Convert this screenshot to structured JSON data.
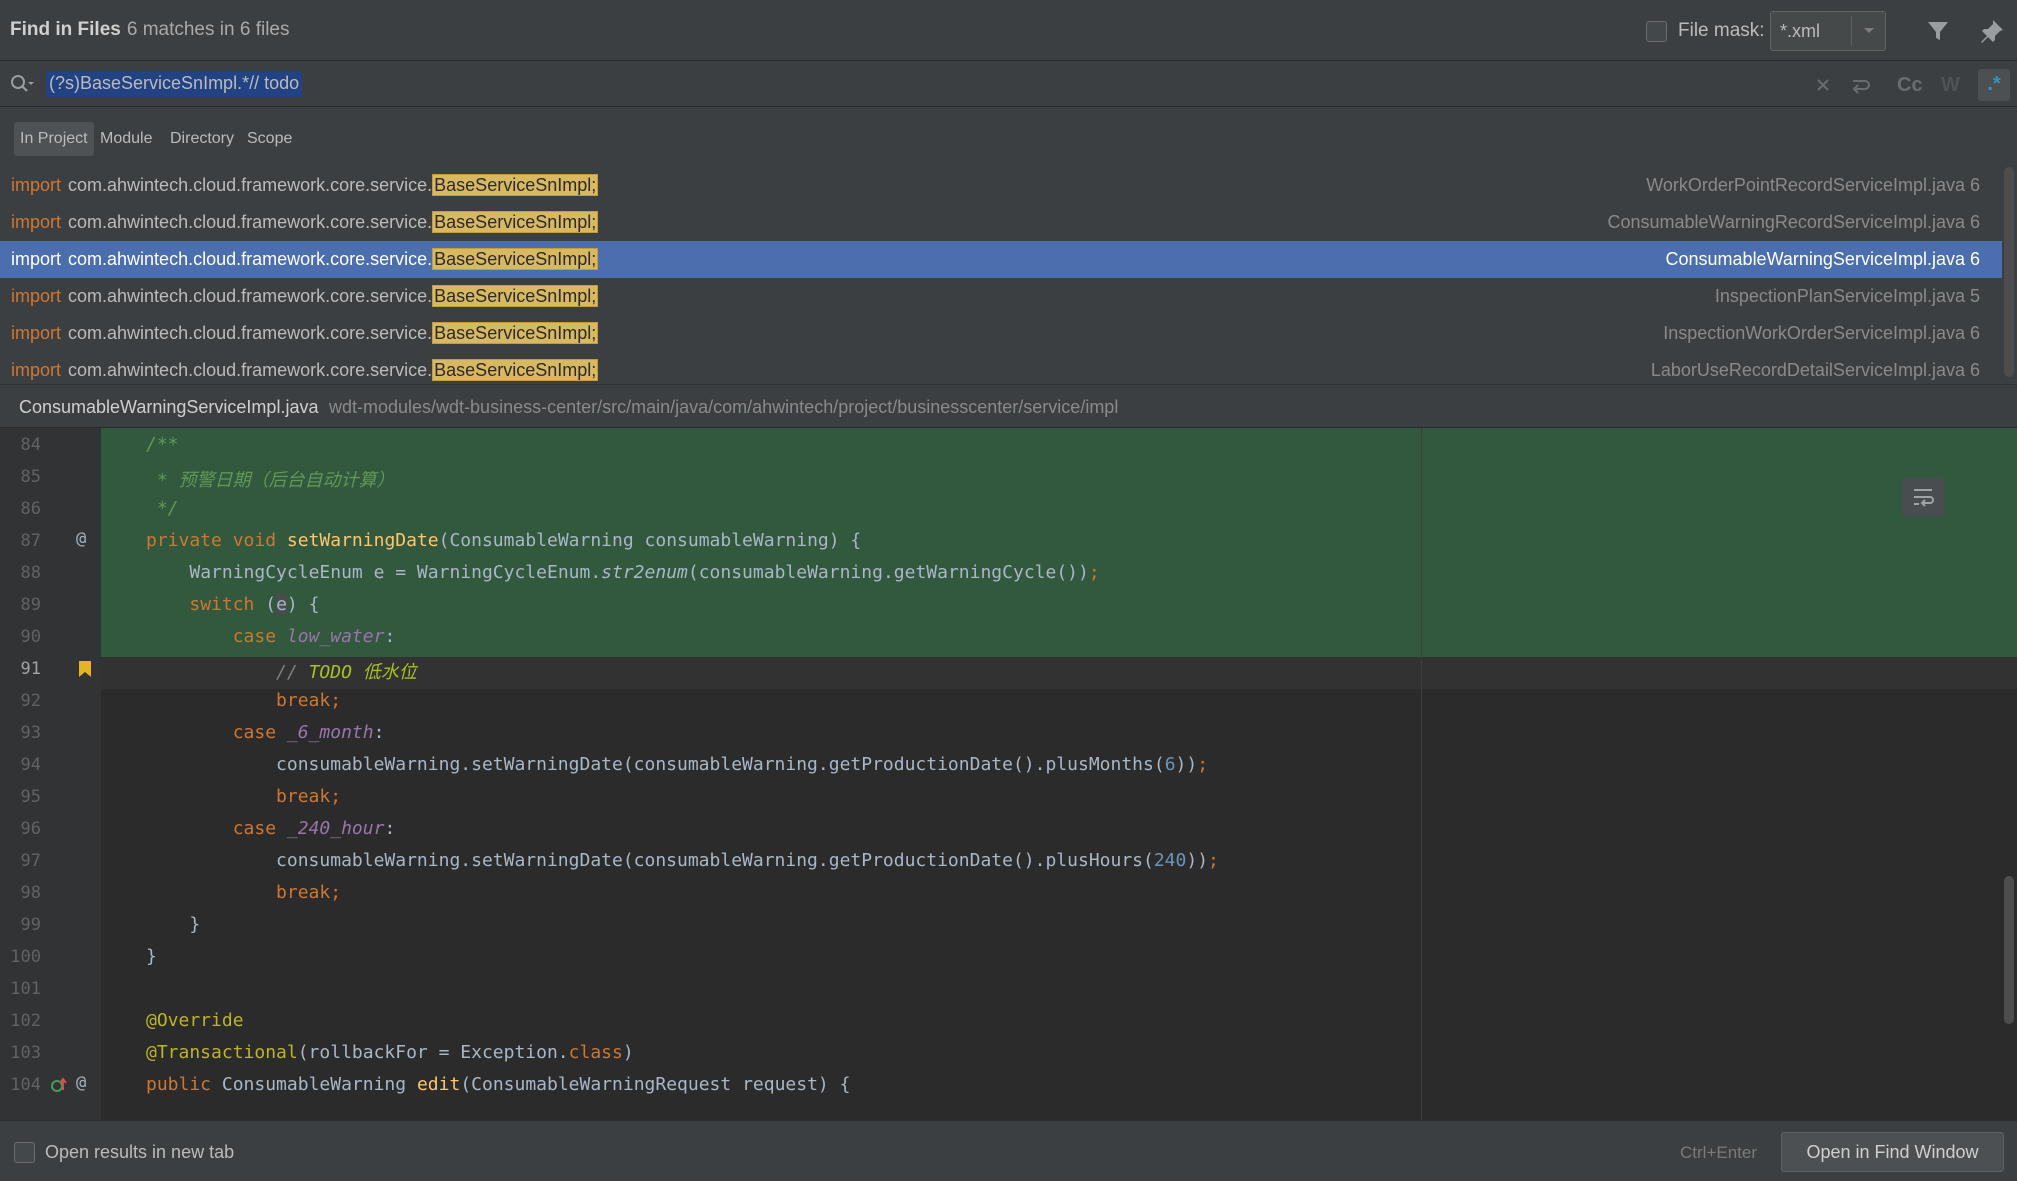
{
  "header": {
    "title": "Find in Files",
    "match_count": "6 matches in 6 files",
    "file_mask_label": "File mask:",
    "file_mask_value": "*.xml",
    "file_mask_checked": false
  },
  "search": {
    "query": "(?s)BaseServiceSnImpl.*// todo",
    "case_label": "Cc",
    "word_label": "W",
    "regex_label": ".*",
    "regex_enabled": true
  },
  "scopes": [
    {
      "label": "In Project",
      "active": true
    },
    {
      "label": "Module",
      "active": false
    },
    {
      "label": "Directory",
      "active": false
    },
    {
      "label": "Scope",
      "active": false
    }
  ],
  "results": [
    {
      "keyword": "import",
      "package": "com.ahwintech.cloud.framework.core.service.",
      "match": "BaseServiceSnImpl;",
      "file": "WorkOrderPointRecordServiceImpl.java 6",
      "selected": false
    },
    {
      "keyword": "import",
      "package": "com.ahwintech.cloud.framework.core.service.",
      "match": "BaseServiceSnImpl;",
      "file": "ConsumableWarningRecordServiceImpl.java 6",
      "selected": false
    },
    {
      "keyword": "import",
      "package": "com.ahwintech.cloud.framework.core.service.",
      "match": "BaseServiceSnImpl;",
      "file": "ConsumableWarningServiceImpl.java 6",
      "selected": true
    },
    {
      "keyword": "import",
      "package": "com.ahwintech.cloud.framework.core.service.",
      "match": "BaseServiceSnImpl;",
      "file": "InspectionPlanServiceImpl.java 5",
      "selected": false
    },
    {
      "keyword": "import",
      "package": "com.ahwintech.cloud.framework.core.service.",
      "match": "BaseServiceSnImpl;",
      "file": "InspectionWorkOrderServiceImpl.java 6",
      "selected": false
    },
    {
      "keyword": "import",
      "package": "com.ahwintech.cloud.framework.core.service.",
      "match": "BaseServiceSnImpl;",
      "file": "LaborUseRecordDetailServiceImpl.java 6",
      "selected": false
    }
  ],
  "preview": {
    "file_name": "ConsumableWarningServiceImpl.java",
    "file_path": "wdt-modules/wdt-business-center/src/main/java/com/ahwintech/project/businesscenter/service/impl",
    "current_line": "91",
    "line_numbers": [
      "84",
      "85",
      "86",
      "87",
      "88",
      "89",
      "90",
      "91",
      "92",
      "93",
      "94",
      "95",
      "96",
      "97",
      "98",
      "99",
      "100",
      "101",
      "102",
      "103",
      "104"
    ],
    "t": {
      "l84": "/**",
      "l85": " * 预警日期（后台自动计算）",
      "l86": " */",
      "private": "private",
      "void": "void",
      "setWarningDate": "setWarningDate",
      "l87_params": "(ConsumableWarning consumableWarning) {",
      "l88_a": "WarningCycleEnum e = WarningCycleEnum.",
      "str2enum": "str2enum",
      "l88_b": "(consumableWarning.getWarningCycle())",
      "semi": ";",
      "switch": "switch",
      "l89_a": " (",
      "e": "e",
      "l89_b": ") {",
      "case": "case",
      "low_water": "low_water",
      "colon": ":",
      "slashes": "// ",
      "TODO": "TODO",
      "todo_text": " 低水位",
      "break": "break",
      "_6_month": "_6_month",
      "set_prod_a": "consumableWarning.setWarningDate(consumableWarning.getProductionDate().plusMonths(",
      "six": "6",
      "close_paren": "))",
      "_240_hour": "_240_hour",
      "set_prod_b": "consumableWarning.setWarningDate(consumableWarning.getProductionDate().plusHours(",
      "n240": "240",
      "brace": "}",
      "override": "@Override",
      "transactional": "@Transactional",
      "l103_a": "(rollbackFor = Exception.",
      "class": "class",
      "l103_b": ")",
      "public": "public",
      "l104_type": "ConsumableWarning",
      "edit": "edit",
      "l104_params": "(ConsumableWarningRequest request) {",
      "gutter_at": "@"
    }
  },
  "footer": {
    "open_new_tab_label": "Open results in new tab",
    "shortcut": "Ctrl+Enter",
    "open_button": "Open in Find Window"
  },
  "colors": {
    "panel_bg": "#3c3f41",
    "editor_bg": "#2b2b2b",
    "selection": "#4b6eaf",
    "match_highlight": "#d9b862",
    "preview_highlight": "#32593d",
    "keyword": "#cc7832",
    "function": "#ffc66d"
  },
  "icons": {
    "filter": "filter-icon",
    "pin": "pin-icon",
    "search": "search-history-icon",
    "clear": "clear-icon",
    "newline": "new-line-icon",
    "soft_wrap": "soft-wrap-icon",
    "bookmark": "bookmark-icon",
    "override": "override-icon",
    "implements": "implements-icon"
  }
}
